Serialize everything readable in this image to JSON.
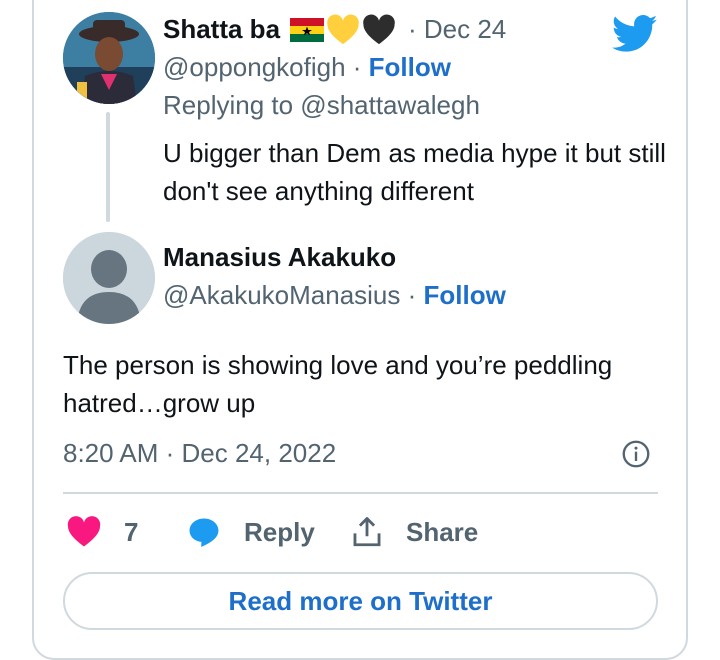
{
  "tweet_parent": {
    "display_name": "Shatta ba",
    "date": "· Dec 24",
    "handle": "@oppongkofigh",
    "separator": " · ",
    "follow_label": "Follow",
    "replying_to": "Replying to @shattawalegh",
    "text": "U bigger than Dem as media hype it but still don't see anything different"
  },
  "tweet_main": {
    "display_name": "Manasius Akakuko",
    "handle": "@AkakukoManasius",
    "separator": " · ",
    "follow_label": "Follow",
    "text": "The person is showing love and you’re peddling hatred…grow up",
    "timestamp": "8:20 AM · Dec 24, 2022"
  },
  "actions": {
    "like_count": "7",
    "reply_label": "Reply",
    "share_label": "Share"
  },
  "read_more_label": "Read more on Twitter",
  "colors": {
    "link": "#1d6fc9",
    "like": "#f91880",
    "reply": "#1d9bf0",
    "twitter": "#1d9bf0"
  }
}
